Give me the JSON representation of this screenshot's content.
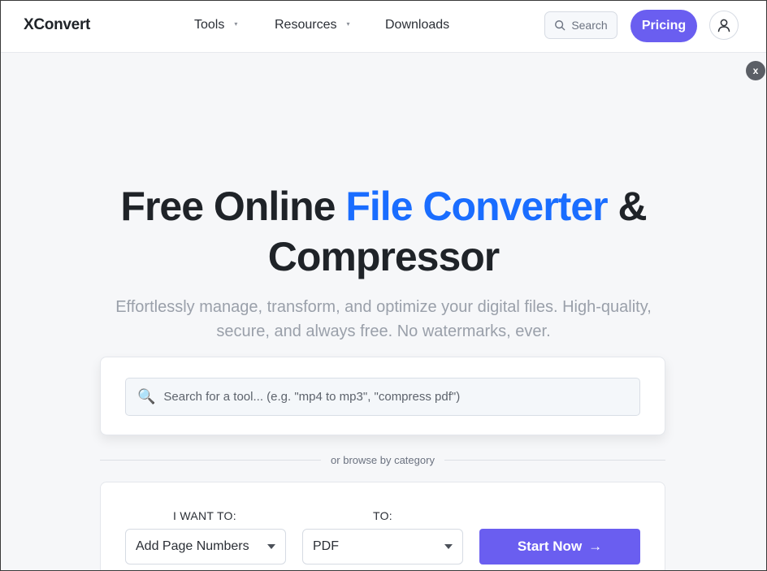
{
  "header": {
    "logo": "XConvert",
    "nav": [
      {
        "label": "Tools",
        "has_caret": true
      },
      {
        "label": "Resources",
        "has_caret": true
      },
      {
        "label": "Downloads",
        "has_caret": false
      }
    ],
    "caret": "▾",
    "search_label": "Search",
    "pricing_label": "Pricing",
    "user_icon": "user-icon"
  },
  "close_label": "x",
  "hero": {
    "title_part1": "Free Online ",
    "title_accent": "File Converter",
    "title_part2": " &",
    "title_line2": "Compressor",
    "subtitle": "Effortlessly manage, transform, and optimize your digital files. High-quality, secure, and always free. No watermarks, ever."
  },
  "tool_search": {
    "icon": "🔍",
    "placeholder": "Search for a tool... (e.g. \"mp4 to mp3\", \"compress pdf\")",
    "value": ""
  },
  "divider_text": "or browse by category",
  "converter": {
    "from_label": "I WANT TO:",
    "from_value": "Add Page Numbers",
    "to_label": "TO:",
    "to_value": "PDF",
    "start_label": "Start Now",
    "start_icon": "→"
  },
  "colors": {
    "accent": "#1a6dff",
    "brand_purple": "#6a5ef0"
  }
}
